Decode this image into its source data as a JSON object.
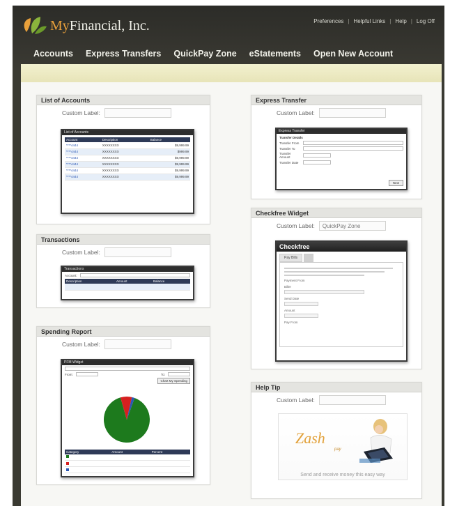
{
  "brand": {
    "name_prefix": "My",
    "name_rest": "Financial, Inc."
  },
  "top_links": [
    "Preferences",
    "Helpful Links",
    "Help",
    "Log Off"
  ],
  "nav": [
    "Accounts",
    "Express Transfers",
    "QuickPay Zone",
    "eStatements",
    "Open New Account"
  ],
  "widgets": {
    "accounts": {
      "title": "List of Accounts",
      "custom_label_text": "Custom Label:",
      "custom_label_value": "",
      "preview_title": "List of Accounts",
      "columns": [
        "Account",
        "Description",
        "Balance"
      ],
      "rows": [
        {
          "account": "****4444",
          "desc": "XXXXXXXX",
          "balance": "$9,999.99"
        },
        {
          "account": "****4444",
          "desc": "XXXXXXXX",
          "balance": "$999.99"
        },
        {
          "account": "****4444",
          "desc": "XXXXXXXX",
          "balance": "$9,999.99"
        },
        {
          "account": "****4444",
          "desc": "XXXXXXXX",
          "balance": "$9,999.99"
        },
        {
          "account": "****4444",
          "desc": "XXXXXXXX",
          "balance": "$9,999.99"
        },
        {
          "account": "****4444",
          "desc": "XXXXXXXX",
          "balance": "$9,999.99"
        }
      ]
    },
    "transactions": {
      "title": "Transactions",
      "custom_label_text": "Custom Label:",
      "custom_label_value": "",
      "preview_title": "Transactions",
      "account_label": "Account:",
      "columns": [
        "Description",
        "Amount",
        "Balance"
      ]
    },
    "spending": {
      "title": "Spending Report",
      "custom_label_text": "Custom Label:",
      "custom_label_value": "",
      "preview_title": "PFM Widget",
      "from_label": "From:",
      "to_label": "To:",
      "button_label": "Chart My Spending",
      "legend_columns": [
        "Category",
        "Amount",
        "Percent"
      ]
    },
    "express": {
      "title": "Express Transfer",
      "custom_label_text": "Custom Label:",
      "custom_label_value": "",
      "preview_title": "Express Transfer",
      "section_title": "Transfer Details",
      "fields": [
        "Transfer From",
        "Transfer To",
        "Transfer Amount",
        "Transfer Date"
      ],
      "submit_label": "Next"
    },
    "checkfree": {
      "title": "Checkfree Widget",
      "custom_label_text": "Custom Label:",
      "custom_label_value": "QuickPay Zone",
      "widget_header": "Checkfree",
      "tabs": [
        "Pay Bills"
      ],
      "field_labels": [
        "Payment From",
        "Biller",
        "Send Date",
        "Amount",
        "Pay From"
      ]
    },
    "help": {
      "title": "Help Tip",
      "custom_label_text": "Custom Label:",
      "custom_label_value": "",
      "logo_text": "Zash",
      "logo_sub": "pay",
      "caption": "Send and receive money this easy way"
    }
  },
  "colors": {
    "header_bg": "#2c2c28",
    "band": "#ece9bf",
    "pie_main": "#1d7a1d",
    "pie_slice": "#d62020",
    "link_blue": "#2a56b3",
    "logo_orange": "#e9a03b"
  },
  "chart_data": {
    "type": "pie",
    "categories": [
      "",
      "",
      ""
    ],
    "values": [
      90,
      8,
      2
    ],
    "colors": [
      "#1d7a1d",
      "#d62020",
      "#2a56b3"
    ]
  }
}
